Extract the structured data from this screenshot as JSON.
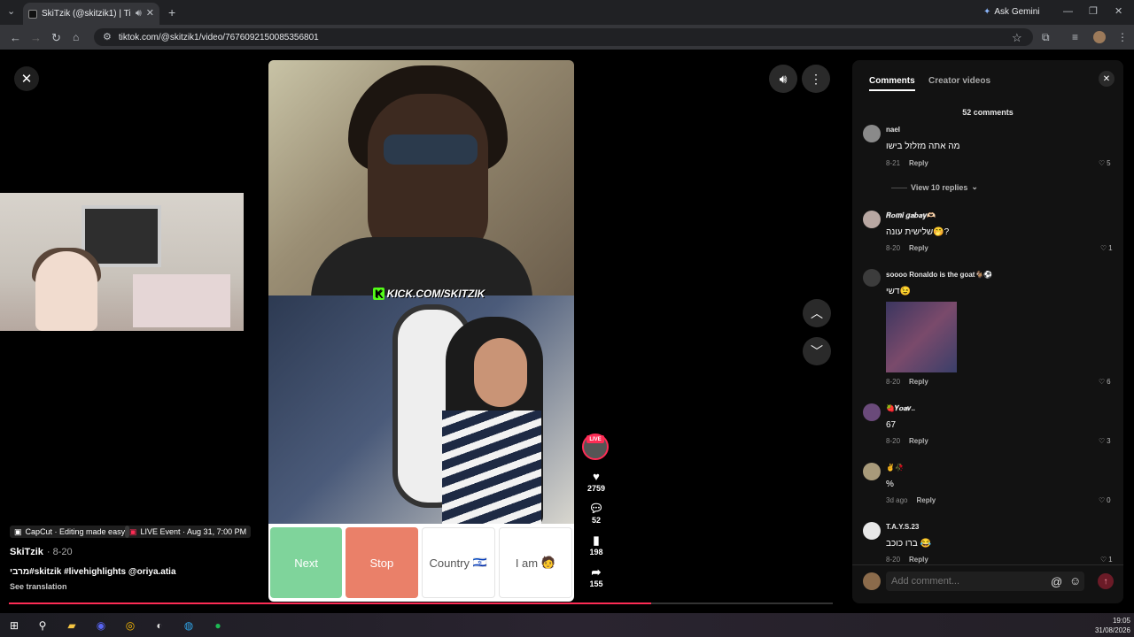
{
  "browser": {
    "tab_title": "SkiTzik (@skitzik1) | TikTok",
    "url": "tiktok.com/@skitzik1/video/7676092150085356801",
    "ask_gemini": "Ask Gemini"
  },
  "video": {
    "overlay_text": "KICK.COM/SKITZIK",
    "buttons": {
      "next": "Next",
      "stop": "Stop",
      "country": "Country",
      "country_flag": "🇮🇱",
      "iam": "I am",
      "iam_emoji": "🧑"
    },
    "live_badge": "LIVE",
    "likes": "2759",
    "comments": "52",
    "saves": "198",
    "shares": "155",
    "progress_fraction": 0.78
  },
  "info": {
    "chip_capcut": "CapCut · Editing made easy",
    "chip_live": "LIVE Event · Aug 31, 7:00 PM",
    "author": "SkiTzik",
    "date": "· 8-20",
    "caption": "מרבי#skitzik #livehighlights @oriya.atia",
    "see_translation": "See translation"
  },
  "panel": {
    "tab_comments": "Comments",
    "tab_creator": "Creator videos",
    "count": "52 comments",
    "add_comment_placeholder": "Add comment...",
    "reply_label": "Reply",
    "comments": [
      {
        "user": "nael",
        "text": "מה אתה מזלזל בישו",
        "date": "8-21",
        "likes": "5",
        "view_replies": "View 10 replies"
      },
      {
        "user": "𝑹𝒐𝒎𝒊 𝒈𝒂𝒃𝒂𝒚🫶🏻",
        "text": "שלישית עונה🤭?",
        "date": "8-20",
        "likes": "1"
      },
      {
        "user": "soooo Ronaldo is the goat🐐⚽",
        "text": "דשי😉",
        "date": "8-20",
        "likes": "6"
      },
      {
        "user": "🍓𝒀𝒐𝒂𝒗..",
        "text": "67",
        "date": "8-20",
        "likes": "3"
      },
      {
        "user": "✌️🥀",
        "text": "%",
        "date": "3d ago",
        "likes": "0"
      },
      {
        "user": "T.A.Y.S.23",
        "text": "ברו כוכב 😂",
        "date": "8-20",
        "likes": "1"
      }
    ]
  },
  "taskbar": {
    "time": "19:05",
    "date": "31/08/2026"
  }
}
